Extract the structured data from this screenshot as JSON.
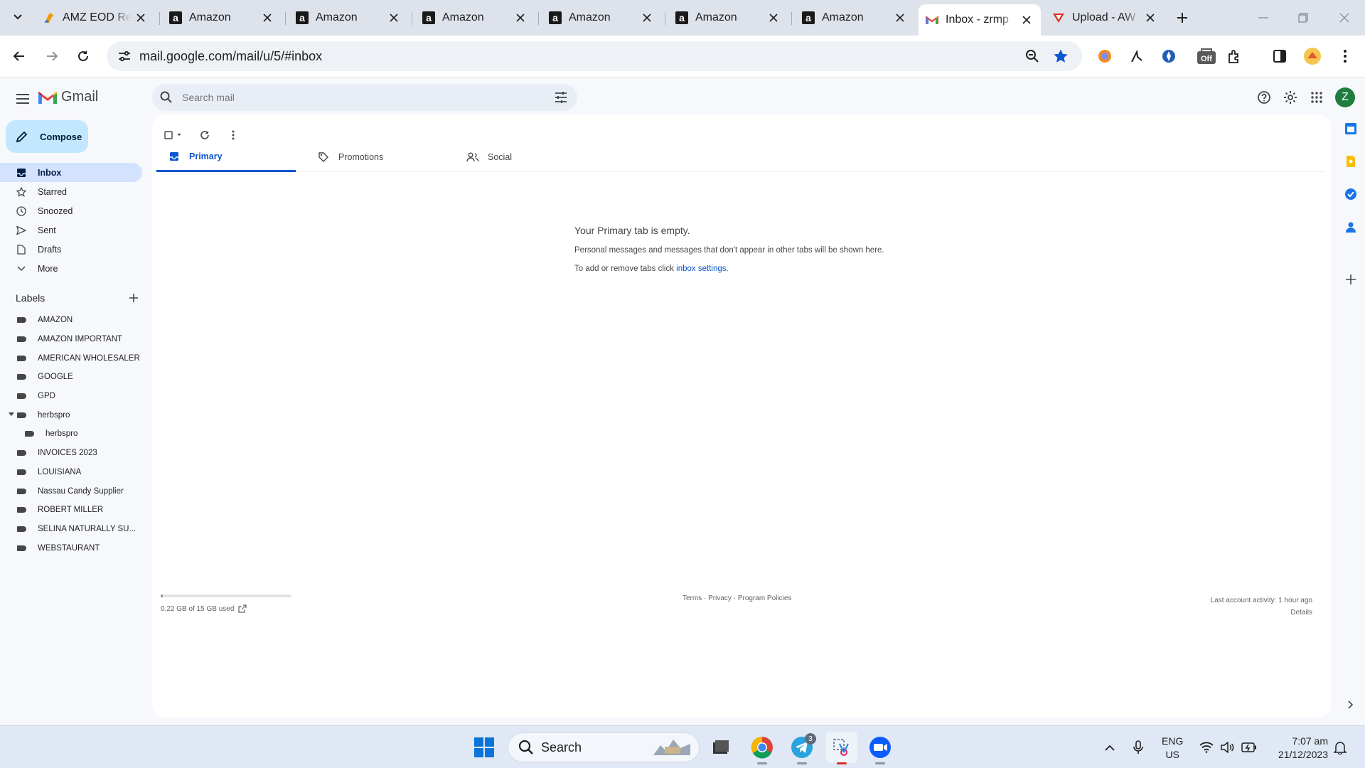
{
  "browser": {
    "tabs": [
      {
        "title": "AMZ EOD Re",
        "favicon": "sheets-icon"
      },
      {
        "title": "Amazon",
        "favicon": "amazon-icon"
      },
      {
        "title": "Amazon",
        "favicon": "amazon-icon"
      },
      {
        "title": "Amazon",
        "favicon": "amazon-icon"
      },
      {
        "title": "Amazon",
        "favicon": "amazon-icon"
      },
      {
        "title": "Amazon",
        "favicon": "amazon-icon"
      },
      {
        "title": "Amazon",
        "favicon": "amazon-icon"
      },
      {
        "title": "Inbox - zrmp",
        "favicon": "gmail-icon",
        "active": true
      },
      {
        "title": "Upload - AW",
        "favicon": "upload-icon"
      }
    ],
    "url": "mail.google.com/mail/u/5/#inbox",
    "extension_badge": "Off"
  },
  "gmail": {
    "app_name": "Gmail",
    "search_placeholder": "Search mail",
    "compose_label": "Compose",
    "account_initial": "Z",
    "nav": [
      {
        "label": "Inbox",
        "icon": "inbox-icon",
        "active": true
      },
      {
        "label": "Starred",
        "icon": "star-icon"
      },
      {
        "label": "Snoozed",
        "icon": "clock-icon"
      },
      {
        "label": "Sent",
        "icon": "send-icon"
      },
      {
        "label": "Drafts",
        "icon": "draft-icon"
      },
      {
        "label": "More",
        "icon": "chevron-down-icon"
      }
    ],
    "labels_heading": "Labels",
    "labels": [
      "AMAZON",
      "AMAZON IMPORTANT",
      "AMERICAN WHOLESALER",
      "GOOGLE",
      "GPD",
      "herbspro",
      "herbspro",
      "INVOICES 2023",
      "LOUISIANA",
      "Nassau Candy Supplier",
      "ROBERT MILLER",
      "SELINA NATURALLY SU...",
      "WEBSTAURANT"
    ],
    "category_tabs": [
      {
        "label": "Primary",
        "icon": "inbox-icon",
        "active": true
      },
      {
        "label": "Promotions",
        "icon": "tag-icon"
      },
      {
        "label": "Social",
        "icon": "people-icon"
      }
    ],
    "empty_state": {
      "heading": "Your Primary tab is empty.",
      "line1": "Personal messages and messages that don't appear in other tabs will be shown here.",
      "line2_prefix": "To add or remove tabs click ",
      "line2_link": "inbox settings",
      "line2_suffix": "."
    },
    "footer": {
      "storage_text": "0.22 GB of 15 GB used",
      "storage_fraction": 0.015,
      "terms": "Terms",
      "privacy": "Privacy",
      "policies": "Program Policies",
      "activity": "Last account activity: 1 hour ago",
      "details": "Details"
    }
  },
  "taskbar": {
    "search_label": "Search",
    "telegram_badge": "3",
    "lang_line1": "ENG",
    "lang_line2": "US",
    "time": "7:07 am",
    "date": "21/12/2023"
  }
}
